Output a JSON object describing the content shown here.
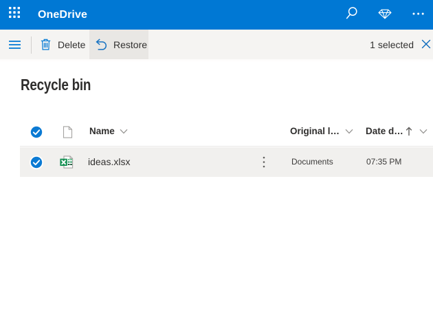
{
  "colors": {
    "brand_blue": "#0078d4",
    "command_bar_bg": "#f5f4f2",
    "hovered_button_bg": "#e9e7e4",
    "selected_row_bg": "#f1f0ee",
    "text_primary": "#323130",
    "text_secondary": "#3b3a39",
    "icon_gray": "#a19f9d",
    "excel_green": "#107c41"
  },
  "suite_bar": {
    "app_name": "OneDrive",
    "icons": [
      "app-launcher-waffle",
      "search",
      "premium-diamond",
      "more-ellipsis"
    ]
  },
  "command_bar": {
    "delete_label": "Delete",
    "restore_label": "Restore",
    "selection_status": "1 selected",
    "icons": [
      "menu-hamburger",
      "trash",
      "restore-undo-arrow",
      "dismiss-x"
    ]
  },
  "page": {
    "title": "Recycle bin"
  },
  "table": {
    "columns": {
      "name": {
        "label": "Name"
      },
      "original_location": {
        "label": "Original l…"
      },
      "date_deleted": {
        "label": "Date d…",
        "sort_direction": "ascending"
      }
    },
    "rows": [
      {
        "name": "ideas.xlsx",
        "file_type": "xlsx",
        "original_location": "Documents",
        "date_deleted": "07:35 PM",
        "selected": true
      }
    ]
  }
}
